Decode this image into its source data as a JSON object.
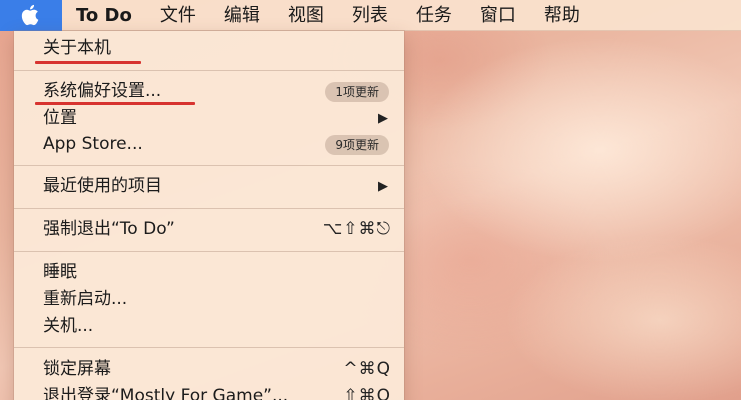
{
  "menubar": {
    "app_name": "To Do",
    "items": [
      "文件",
      "编辑",
      "视图",
      "列表",
      "任务",
      "窗口",
      "帮助"
    ]
  },
  "apple_menu": {
    "about": "关于本机",
    "system_prefs": "系统偏好设置...",
    "system_prefs_badge": "1项更新",
    "location": "位置",
    "app_store": "App Store...",
    "app_store_badge": "9项更新",
    "recent_items": "最近使用的项目",
    "force_quit": "强制退出“To Do”",
    "force_quit_shortcut": "⌥⇧⌘⎋",
    "sleep": "睡眠",
    "restart": "重新启动...",
    "shutdown": "关机...",
    "lock_screen": "锁定屏幕",
    "lock_screen_shortcut": "^⌘Q",
    "logout": "退出登录“Mostly For Game”...",
    "logout_shortcut": "⇧⌘Q",
    "submenu_arrow": "▶"
  },
  "colors": {
    "apple_highlight": "#3a7ee8",
    "annotation_underline": "#d7332f"
  },
  "icons": {
    "apple": "apple-logo-icon"
  }
}
